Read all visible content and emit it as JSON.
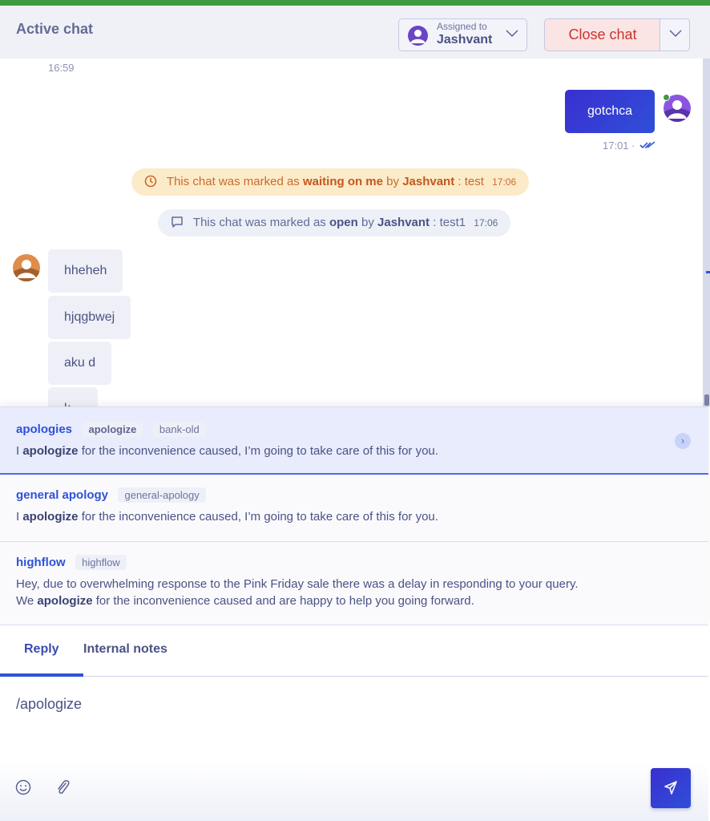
{
  "header": {
    "title": "Active chat",
    "assigned_label": "Assigned to",
    "assigned_name": "Jashvant",
    "close_chat_label": "Close chat"
  },
  "colors": {
    "top_bar": "#3f9a42",
    "accent": "#2f52d8",
    "close_chat_bg": "#fbe4e4",
    "close_chat_text": "#c8342c",
    "waiting_bg": "#fcebc9",
    "waiting_text": "#c96a2e"
  },
  "messages": {
    "top_timestamp": "16:59",
    "outgoing": {
      "text": "gotchca",
      "time": "17:01",
      "separator": "·",
      "status_icon": "double-check-icon"
    },
    "system_events": [
      {
        "icon": "clock-icon",
        "prefix": "This chat was marked as",
        "status": "waiting on me",
        "by": "by",
        "agent": "Jashvant",
        "note": ": test",
        "time": "17:06"
      },
      {
        "icon": "chat-bubble-icon",
        "prefix": "This chat was marked as",
        "status": "open",
        "by": "by",
        "agent": "Jashvant",
        "note": ": test1",
        "time": "17:06"
      }
    ],
    "incoming": [
      "hheheh",
      "hjqgbwej",
      "aku d",
      "k"
    ]
  },
  "canned_responses": [
    {
      "title": "apologies",
      "tags": [
        "apologize",
        "bank-old"
      ],
      "body_pre": "I",
      "body_bold": "apologize",
      "body_post": "for the inconvenience caused, I’m going to take care of this for you.",
      "selected": true
    },
    {
      "title": "general apology",
      "tags": [
        "general-apology"
      ],
      "body_pre": "I",
      "body_bold": "apologize",
      "body_post": "for the inconvenience caused, I’m going to take care of this for you.",
      "selected": false
    },
    {
      "title": "highflow",
      "tags": [
        "highflow"
      ],
      "body_line1": "Hey, due to overwhelming response to the Pink Friday sale there was a delay in responding to your query.",
      "body_pre": "We",
      "body_bold": "apologize",
      "body_post": "for the inconvenience caused and are happy to help you going forward.",
      "selected": false
    }
  ],
  "composer": {
    "tabs": [
      {
        "label": "Reply",
        "active": true
      },
      {
        "label": "Internal notes",
        "active": false
      }
    ],
    "input_value": "/apologize",
    "tools": [
      "emoji-icon",
      "attachment-icon"
    ],
    "send_icon": "send-icon"
  }
}
